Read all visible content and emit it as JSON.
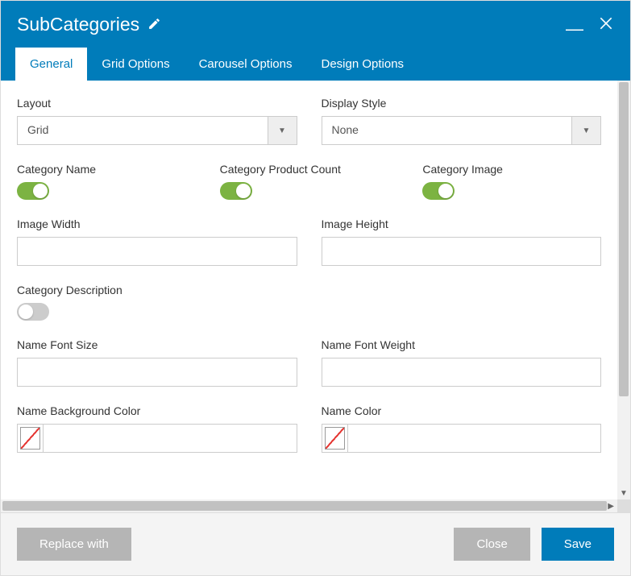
{
  "header": {
    "title": "SubCategories"
  },
  "tabs": [
    {
      "label": "General",
      "active": true
    },
    {
      "label": "Grid Options",
      "active": false
    },
    {
      "label": "Carousel Options",
      "active": false
    },
    {
      "label": "Design Options",
      "active": false
    }
  ],
  "fields": {
    "layout": {
      "label": "Layout",
      "value": "Grid"
    },
    "displayStyle": {
      "label": "Display Style",
      "value": "None"
    },
    "categoryName": {
      "label": "Category Name",
      "on": true
    },
    "categoryProductCount": {
      "label": "Category Product Count",
      "on": true
    },
    "categoryImage": {
      "label": "Category Image",
      "on": true
    },
    "imageWidth": {
      "label": "Image Width",
      "value": ""
    },
    "imageHeight": {
      "label": "Image Height",
      "value": ""
    },
    "categoryDescription": {
      "label": "Category Description",
      "on": false
    },
    "nameFontSize": {
      "label": "Name Font Size",
      "value": ""
    },
    "nameFontWeight": {
      "label": "Name Font Weight",
      "value": ""
    },
    "nameBackgroundColor": {
      "label": "Name Background Color",
      "value": ""
    },
    "nameColor": {
      "label": "Name Color",
      "value": ""
    }
  },
  "footer": {
    "replaceWith": "Replace with",
    "close": "Close",
    "save": "Save"
  }
}
